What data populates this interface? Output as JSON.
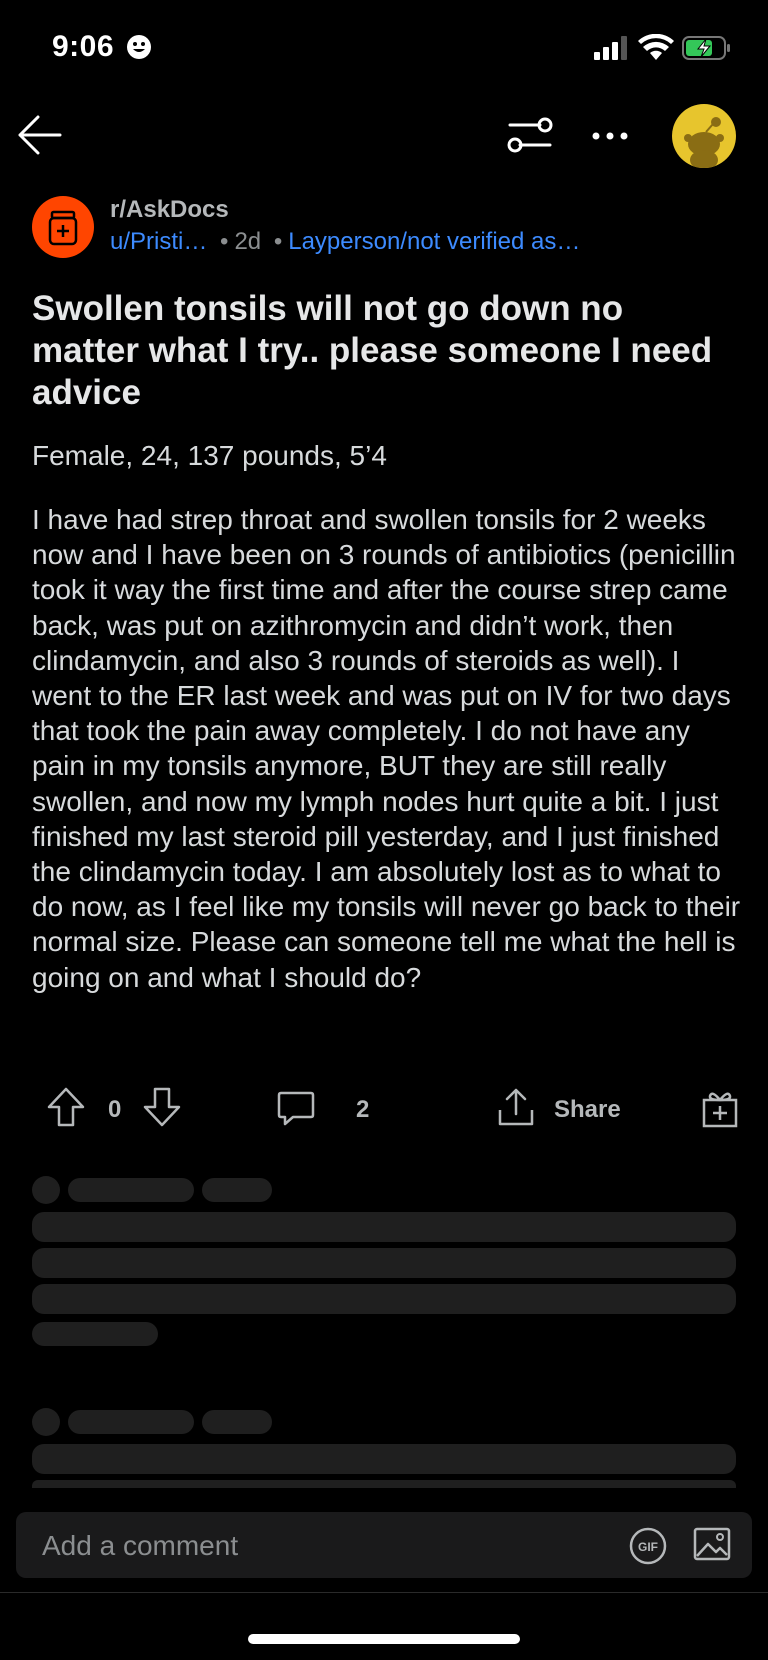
{
  "status_bar": {
    "time": "9:06"
  },
  "nav": {
    "back_icon": "arrow-left-icon",
    "filter_icon": "sliders-icon",
    "more_icon": "ellipsis-icon",
    "avatar_icon": "snoo-avatar"
  },
  "post": {
    "subreddit": "r/AskDocs",
    "author": "u/Pristi…",
    "age": "2d",
    "flair": "Layperson/not verified as…",
    "title": "Swollen tonsils will not go down no matter what I try.. please someone I need advice",
    "subline": "Female, 24, 137 pounds, 5’4",
    "body": "I have had strep throat and swollen tonsils for 2 weeks now and I have been on 3 rounds of antibiotics (penicillin took it way the first time and after the course strep came back, was put on azithromycin and didn’t work, then clindamycin, and also 3 rounds of steroids as well). I went to the ER last week and was put on IV for two days that took the pain away completely. I do not have any pain in my tonsils anymore, BUT they are still really swollen, and now my lymph nodes hurt quite a bit. I just finished my last steroid pill yesterday, and I just finished the clindamycin today. I am absolutely lost as to what to do now, as I feel like my tonsils will never go back to their normal size. Please can someone tell me what the hell is going on and what I should do?"
  },
  "actions": {
    "score": "0",
    "comments": "2",
    "share": "Share"
  },
  "comment_input": {
    "placeholder": "Add a comment"
  },
  "colors": {
    "background": "#000000",
    "accent_blue": "#3d8bff",
    "subreddit_icon": "#ff4500",
    "avatar": "#e7c52d"
  }
}
